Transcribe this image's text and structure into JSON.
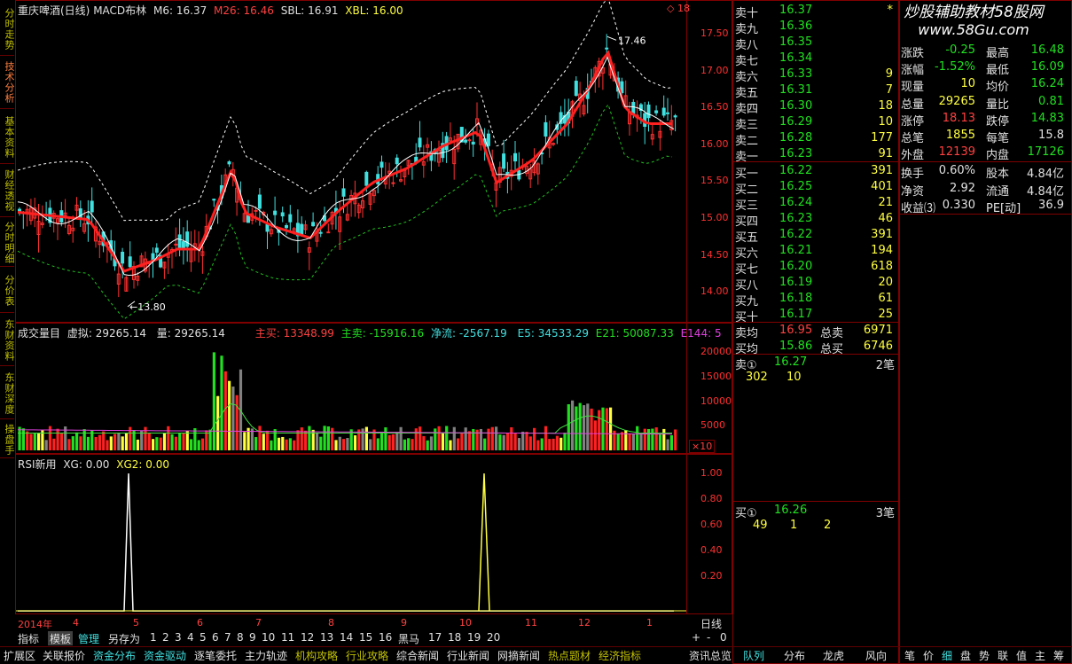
{
  "left_tabs": [
    "分时走势",
    "技术分析",
    "基本资料",
    "财经透视",
    "分时明细",
    "分价表",
    "东财资料",
    "东财深度",
    "操盘手"
  ],
  "main_header": {
    "title": "重庆啤酒(日线)",
    "indicator": "MACD布林",
    "m6": "M6: 16.37",
    "m26": "M26: 16.46",
    "sbl": "SBL: 16.91",
    "xbl": "XBL: 16.00",
    "corner": "◇ 18"
  },
  "price_axis": [
    "17.50",
    "17.00",
    "16.50",
    "16.00",
    "15.50",
    "15.00",
    "14.50",
    "14.00"
  ],
  "high_label": "17.46",
  "low_label": "13.80",
  "volume_header": {
    "title": "成交量目",
    "virtual": "虚拟: 29265.14",
    "volume": "量: 29265.14",
    "zhumai": "主买: 13348.99",
    "zhumai2": "主卖: -15916.16",
    "jingliu": "净流: -2567.19",
    "e5": "E5: 34533.29",
    "e21": "E21: 50087.33",
    "e144": "E144: 5"
  },
  "volume_axis": [
    "20000",
    "15000",
    "10000",
    "5000"
  ],
  "volume_unit": "×10",
  "rsi_header": {
    "title": "RSI新用",
    "xg": "XG: 0.00",
    "xg2": "XG2: 0.00"
  },
  "rsi_axis": [
    "1.00",
    "0.80",
    "0.60",
    "0.40",
    "0.20"
  ],
  "months": {
    "year": "2014年",
    "labels": [
      "4",
      "5",
      "6",
      "7",
      "8",
      "9",
      "10",
      "11",
      "12",
      "1"
    ]
  },
  "period": "日线",
  "zoom": [
    "+",
    "-",
    "0"
  ],
  "bottom_tabs": [
    "指标",
    "模板",
    "管理",
    "另存为",
    "1",
    "2",
    "3",
    "4",
    "5",
    "6",
    "7",
    "8",
    "9",
    "10",
    "11",
    "12",
    "13",
    "14",
    "15",
    "16",
    "黑马",
    "17",
    "18",
    "19",
    "20"
  ],
  "footer_tabs": [
    "扩展区",
    "关联报价",
    "资金分布",
    "资金驱动",
    "逐笔委托",
    "主力轨迹",
    "机构攻略",
    "行业攻略",
    "综合新闻",
    "行业新闻",
    "网摘新闻",
    "热点题材",
    "经济指标"
  ],
  "footer_right": [
    "资讯总览",
    "队列",
    "分布",
    "龙虎",
    "风向"
  ],
  "footer_far": [
    "笔",
    "价",
    "细",
    "盘",
    "势",
    "联",
    "值",
    "主",
    "筹"
  ],
  "sell_orders": [
    {
      "label": "卖十",
      "price": "16.37",
      "vol": "*"
    },
    {
      "label": "卖九",
      "price": "16.36",
      "vol": ""
    },
    {
      "label": "卖八",
      "price": "16.35",
      "vol": ""
    },
    {
      "label": "卖七",
      "price": "16.34",
      "vol": ""
    },
    {
      "label": "卖六",
      "price": "16.33",
      "vol": "9"
    },
    {
      "label": "卖五",
      "price": "16.31",
      "vol": "7"
    },
    {
      "label": "卖四",
      "price": "16.30",
      "vol": "18"
    },
    {
      "label": "卖三",
      "price": "16.29",
      "vol": "10"
    },
    {
      "label": "卖二",
      "price": "16.28",
      "vol": "177"
    },
    {
      "label": "卖一",
      "price": "16.23",
      "vol": "91"
    }
  ],
  "buy_orders": [
    {
      "label": "买一",
      "price": "16.22",
      "vol": "391"
    },
    {
      "label": "买二",
      "price": "16.25",
      "vol": "401"
    },
    {
      "label": "买三",
      "price": "16.24",
      "vol": "21"
    },
    {
      "label": "买四",
      "price": "16.23",
      "vol": "46"
    },
    {
      "label": "买五",
      "price": "16.22",
      "vol": "391"
    },
    {
      "label": "买六",
      "price": "16.21",
      "vol": "194"
    },
    {
      "label": "买七",
      "price": "16.20",
      "vol": "618"
    },
    {
      "label": "买八",
      "price": "16.19",
      "vol": "20"
    },
    {
      "label": "买九",
      "price": "16.18",
      "vol": "61"
    },
    {
      "label": "买十",
      "price": "16.17",
      "vol": "25"
    }
  ],
  "avg": {
    "sell_label": "卖均",
    "sell_price": "16.95",
    "sell_total_label": "总卖",
    "sell_total": "6971",
    "buy_label": "买均",
    "buy_price": "15.86",
    "buy_total_label": "总买",
    "buy_total": "6746"
  },
  "queue_sell": {
    "label": "卖①",
    "price": "16.27",
    "count": "2笔",
    "q1": "302",
    "q2": "10"
  },
  "queue_buy": {
    "label": "买①",
    "price": "16.26",
    "count": "3笔",
    "q1": "49",
    "q2": "1",
    "q3": "2"
  },
  "watermark": {
    "line1": "炒股辅助教材58股网",
    "line2": "www.58Gu.com"
  },
  "quote": [
    {
      "a": "涨跌",
      "av": "-0.25",
      "b": "最高",
      "bv": "16.48"
    },
    {
      "a": "涨幅",
      "av": "-1.52%",
      "b": "最低",
      "bv": "16.09"
    },
    {
      "a": "现量",
      "av": "10",
      "b": "均价",
      "bv": "16.24"
    },
    {
      "a": "总量",
      "av": "29265",
      "b": "量比",
      "bv": "0.81"
    },
    {
      "a": "涨停",
      "av": "18.13",
      "b": "跌停",
      "bv": "14.83"
    },
    {
      "a": "总笔",
      "av": "1855",
      "b": "每笔",
      "bv": "15.8"
    },
    {
      "a": "外盘",
      "av": "12139",
      "b": "内盘",
      "bv": "17126"
    }
  ],
  "quote2": [
    {
      "a": "换手",
      "av": "0.60%",
      "b": "股本",
      "bv": "4.84亿"
    },
    {
      "a": "净资",
      "av": "2.92",
      "b": "流通",
      "bv": "4.84亿"
    },
    {
      "a": "收益⑶",
      "av": "0.330",
      "b": "PE[动]",
      "bv": "36.9"
    }
  ],
  "colors": {
    "up": "#ff3030",
    "down": "#40e0e0",
    "border": "#800000",
    "ma": "#ff2020",
    "text_yellow": "#ffff40",
    "text_green": "#20e020"
  }
}
